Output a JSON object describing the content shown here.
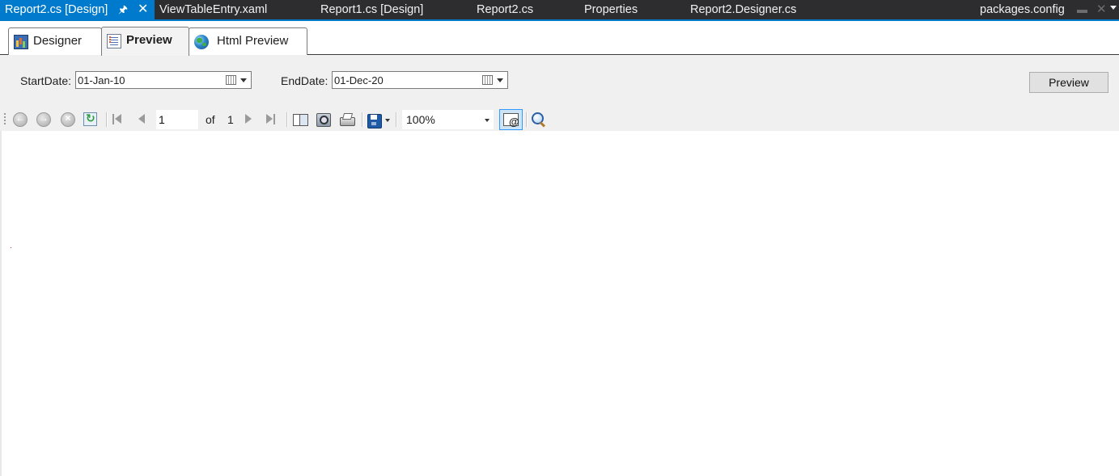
{
  "doc_tabs": {
    "active": {
      "label": "Report2.cs [Design]"
    },
    "items": [
      "ViewTableEntry.xaml",
      "Report1.cs [Design]",
      "Report2.cs",
      "Properties",
      "Report2.Designer.cs",
      "packages.config"
    ]
  },
  "view_tabs": {
    "designer": "Designer",
    "preview": "Preview",
    "html_preview": "Html Preview",
    "selected": "Preview"
  },
  "parameters": {
    "start_label": "StartDate:",
    "start_value": "01-Jan-10",
    "end_label": "EndDate:",
    "end_value": "01-Dec-20",
    "preview_button": "Preview"
  },
  "toolbar": {
    "current_page": "1",
    "of_label": "of",
    "total_pages": "1",
    "zoom": "100%"
  },
  "icons": {
    "back": "back-arrow-icon",
    "forward": "forward-arrow-icon",
    "stop": "stop-icon",
    "refresh": "refresh-icon",
    "first": "first-page-icon",
    "previous": "previous-page-icon",
    "next": "next-page-icon",
    "last": "last-page-icon",
    "document_map": "document-map-icon",
    "print_layout": "print-layout-icon",
    "print": "print-icon",
    "export": "save-export-icon",
    "email": "email-icon",
    "find": "find-icon"
  },
  "colors": {
    "accent": "#007acc",
    "tab_strip": "#2d2d30",
    "panel": "#f0f0f0"
  }
}
